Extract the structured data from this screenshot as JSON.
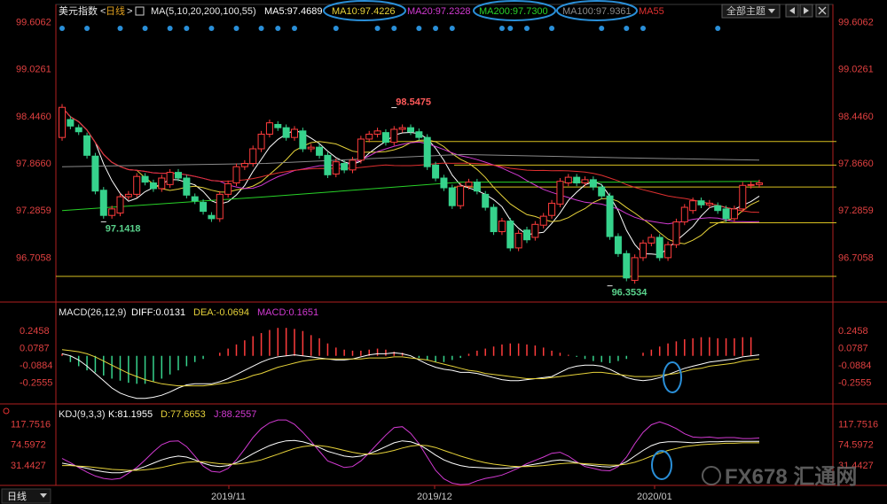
{
  "main_panel": {
    "name": "美元指数",
    "period": "日线",
    "ma_params": "MA(5,10,20,200,100,55)",
    "legend": [
      {
        "label": "MA5:97.4689",
        "color": "#ffffff"
      },
      {
        "label": "MA10:97.4226",
        "color": "#e6d23a"
      },
      {
        "label": "MA20:97.2328",
        "color": "#d23ad2"
      },
      {
        "label": "MA200:97.7300",
        "color": "#28d228"
      },
      {
        "label": "MA100:97.9361",
        "color": "#8a8a8a"
      },
      {
        "label": "MA55",
        "color": "#e03030"
      }
    ],
    "theme_button": "全部主题"
  },
  "macd_panel": {
    "title": "MACD(26,12,9)",
    "legend": [
      {
        "label": "DIFF:0.0131",
        "color": "#ffffff"
      },
      {
        "label": "DEA:-0.0694",
        "color": "#e6d23a"
      },
      {
        "label": "MACD:0.1651",
        "color": "#d23ad2"
      }
    ]
  },
  "kdj_panel": {
    "title": "KDJ(9,3,3)",
    "legend": [
      {
        "label": "K:81.1955",
        "color": "#ffffff"
      },
      {
        "label": "D:77.6653",
        "color": "#e6d23a"
      },
      {
        "label": "J:88.2557",
        "color": "#d23ad2"
      }
    ]
  },
  "bottom_bar": {
    "period": "日线"
  },
  "watermark": "FX678 汇通网",
  "chart_data": {
    "type": "candlestick",
    "price_ticks": [
      "99.6062",
      "99.0261",
      "98.4460",
      "97.8660",
      "97.2859",
      "96.7058"
    ],
    "price_range": [
      96.35,
      99.61
    ],
    "annotations": [
      {
        "label": "98.5475",
        "value": 98.5475
      },
      {
        "label": "97.1418",
        "value": 97.1418
      },
      {
        "label": "96.3534",
        "value": 96.3534
      }
    ],
    "horizontal_levels": [
      98.13,
      97.84,
      97.57,
      97.13,
      96.47
    ],
    "x_labels": [
      "2019/11",
      "2019/12",
      "2020/01"
    ],
    "candles": [
      {
        "o": 98.18,
        "c": 98.55
      },
      {
        "o": 98.4,
        "c": 98.32
      },
      {
        "o": 98.3,
        "c": 98.25
      },
      {
        "o": 98.2,
        "c": 97.96
      },
      {
        "o": 97.95,
        "c": 97.52
      },
      {
        "o": 97.53,
        "c": 97.22
      },
      {
        "o": 97.22,
        "c": 97.3
      },
      {
        "o": 97.25,
        "c": 97.45
      },
      {
        "o": 97.45,
        "c": 97.48
      },
      {
        "o": 97.48,
        "c": 97.7
      },
      {
        "o": 97.7,
        "c": 97.63
      },
      {
        "o": 97.62,
        "c": 97.55
      },
      {
        "o": 97.55,
        "c": 97.68
      },
      {
        "o": 97.6,
        "c": 97.75
      },
      {
        "o": 97.75,
        "c": 97.68
      },
      {
        "o": 97.68,
        "c": 97.47
      },
      {
        "o": 97.45,
        "c": 97.4
      },
      {
        "o": 97.38,
        "c": 97.27
      },
      {
        "o": 97.22,
        "c": 97.18
      },
      {
        "o": 97.18,
        "c": 97.48
      },
      {
        "o": 97.48,
        "c": 97.61
      },
      {
        "o": 97.62,
        "c": 97.82
      },
      {
        "o": 97.82,
        "c": 97.86
      },
      {
        "o": 97.86,
        "c": 98.04
      },
      {
        "o": 98.04,
        "c": 98.22
      },
      {
        "o": 98.22,
        "c": 98.36
      },
      {
        "o": 98.34,
        "c": 98.3
      },
      {
        "o": 98.3,
        "c": 98.18
      },
      {
        "o": 98.18,
        "c": 98.28
      },
      {
        "o": 98.26,
        "c": 98.04
      },
      {
        "o": 98.04,
        "c": 98.06
      },
      {
        "o": 98.06,
        "c": 97.96
      },
      {
        "o": 97.96,
        "c": 97.72
      },
      {
        "o": 97.73,
        "c": 97.88
      },
      {
        "o": 97.86,
        "c": 97.78
      },
      {
        "o": 97.78,
        "c": 97.9
      },
      {
        "o": 97.9,
        "c": 98.16
      },
      {
        "o": 98.16,
        "c": 98.22
      },
      {
        "o": 98.22,
        "c": 98.26
      },
      {
        "o": 98.24,
        "c": 98.12
      },
      {
        "o": 98.12,
        "c": 98.28
      },
      {
        "o": 98.28,
        "c": 98.3
      },
      {
        "o": 98.3,
        "c": 98.25
      },
      {
        "o": 98.25,
        "c": 98.18
      },
      {
        "o": 98.18,
        "c": 97.82
      },
      {
        "o": 97.84,
        "c": 97.68
      },
      {
        "o": 97.68,
        "c": 97.56
      },
      {
        "o": 97.56,
        "c": 97.34
      },
      {
        "o": 97.34,
        "c": 97.58
      },
      {
        "o": 97.58,
        "c": 97.63
      },
      {
        "o": 97.63,
        "c": 97.52
      },
      {
        "o": 97.48,
        "c": 97.32
      },
      {
        "o": 97.32,
        "c": 97.02
      },
      {
        "o": 97.02,
        "c": 97.15
      },
      {
        "o": 97.15,
        "c": 96.82
      },
      {
        "o": 96.82,
        "c": 97.0
      },
      {
        "o": 97.04,
        "c": 96.92
      },
      {
        "o": 96.95,
        "c": 97.11
      },
      {
        "o": 97.1,
        "c": 97.21
      },
      {
        "o": 97.22,
        "c": 97.37
      },
      {
        "o": 97.36,
        "c": 97.64
      },
      {
        "o": 97.62,
        "c": 97.69
      },
      {
        "o": 97.69,
        "c": 97.62
      },
      {
        "o": 97.62,
        "c": 97.66
      },
      {
        "o": 97.66,
        "c": 97.57
      },
      {
        "o": 97.57,
        "c": 97.46
      },
      {
        "o": 97.46,
        "c": 96.96
      },
      {
        "o": 96.96,
        "c": 96.75
      },
      {
        "o": 96.75,
        "c": 96.45
      },
      {
        "o": 96.42,
        "c": 96.7
      },
      {
        "o": 96.7,
        "c": 96.88
      },
      {
        "o": 96.88,
        "c": 96.95
      },
      {
        "o": 96.95,
        "c": 96.7
      },
      {
        "o": 96.7,
        "c": 96.86
      },
      {
        "o": 96.86,
        "c": 97.14
      },
      {
        "o": 97.14,
        "c": 97.32
      },
      {
        "o": 97.28,
        "c": 97.4
      },
      {
        "o": 97.4,
        "c": 97.35
      },
      {
        "o": 97.35,
        "c": 97.37
      },
      {
        "o": 97.34,
        "c": 97.28
      },
      {
        "o": 97.3,
        "c": 97.18
      },
      {
        "o": 97.18,
        "c": 97.3
      },
      {
        "o": 97.3,
        "c": 97.59
      },
      {
        "o": 97.59,
        "c": 97.6
      },
      {
        "o": 97.6,
        "c": 97.62
      }
    ],
    "macd_ticks": [
      "0.2458",
      "0.0787",
      "-0.0884",
      "-0.2555"
    ],
    "macd_range": [
      -0.43,
      0.34
    ],
    "macd_hist": [
      0.02,
      -0.06,
      -0.1,
      -0.14,
      -0.16,
      -0.19,
      -0.22,
      -0.24,
      -0.26,
      -0.27,
      -0.27,
      -0.25,
      -0.22,
      -0.18,
      -0.14,
      -0.1,
      -0.06,
      -0.03,
      0.0,
      0.03,
      0.07,
      0.11,
      0.15,
      0.19,
      0.22,
      0.25,
      0.27,
      0.27,
      0.26,
      0.24,
      0.2,
      0.17,
      0.12,
      0.08,
      0.06,
      0.05,
      0.05,
      0.06,
      0.07,
      0.06,
      0.04,
      0.03,
      0.0,
      -0.02,
      -0.04,
      -0.06,
      -0.06,
      -0.04,
      -0.02,
      0.02,
      0.05,
      0.07,
      0.09,
      0.11,
      0.12,
      0.12,
      0.11,
      0.1,
      0.08,
      0.05,
      0.03,
      0.01,
      -0.01,
      -0.03,
      -0.05,
      -0.06,
      -0.07,
      -0.05,
      -0.03,
      0.0,
      0.03,
      0.06,
      0.09,
      0.12,
      0.14,
      0.16,
      0.17,
      0.18,
      0.18,
      0.17,
      0.17,
      0.17,
      0.18,
      0.18
    ],
    "macd_diff": [
      0.02,
      0.0,
      -0.04,
      -0.1,
      -0.17,
      -0.24,
      -0.31,
      -0.36,
      -0.39,
      -0.41,
      -0.41,
      -0.4,
      -0.38,
      -0.35,
      -0.31,
      -0.28,
      -0.27,
      -0.27,
      -0.27,
      -0.25,
      -0.22,
      -0.18,
      -0.14,
      -0.1,
      -0.06,
      -0.03,
      -0.01,
      0.0,
      0.01,
      0.0,
      -0.01,
      -0.02,
      -0.03,
      -0.04,
      -0.04,
      -0.03,
      -0.01,
      0.01,
      0.02,
      0.02,
      0.03,
      0.02,
      0.0,
      -0.04,
      -0.08,
      -0.11,
      -0.13,
      -0.14,
      -0.16,
      -0.16,
      -0.17,
      -0.19,
      -0.21,
      -0.23,
      -0.24,
      -0.24,
      -0.23,
      -0.22,
      -0.21,
      -0.2,
      -0.16,
      -0.12,
      -0.1,
      -0.09,
      -0.09,
      -0.1,
      -0.13,
      -0.17,
      -0.21,
      -0.23,
      -0.24,
      -0.23,
      -0.21,
      -0.18,
      -0.15,
      -0.12,
      -0.1,
      -0.08,
      -0.06,
      -0.05,
      -0.04,
      -0.03,
      -0.01,
      0.0,
      0.01
    ],
    "macd_dea": [
      0.06,
      0.05,
      0.04,
      0.02,
      -0.01,
      -0.05,
      -0.09,
      -0.13,
      -0.17,
      -0.2,
      -0.23,
      -0.25,
      -0.27,
      -0.28,
      -0.29,
      -0.29,
      -0.29,
      -0.29,
      -0.28,
      -0.27,
      -0.26,
      -0.24,
      -0.22,
      -0.19,
      -0.17,
      -0.14,
      -0.11,
      -0.09,
      -0.07,
      -0.05,
      -0.04,
      -0.03,
      -0.03,
      -0.03,
      -0.03,
      -0.03,
      -0.03,
      -0.02,
      -0.02,
      -0.02,
      -0.01,
      -0.01,
      -0.02,
      -0.03,
      -0.04,
      -0.06,
      -0.08,
      -0.1,
      -0.12,
      -0.14,
      -0.15,
      -0.17,
      -0.18,
      -0.19,
      -0.2,
      -0.21,
      -0.22,
      -0.22,
      -0.22,
      -0.21,
      -0.2,
      -0.19,
      -0.18,
      -0.17,
      -0.16,
      -0.16,
      -0.17,
      -0.18,
      -0.19,
      -0.2,
      -0.2,
      -0.2,
      -0.19,
      -0.18,
      -0.17,
      -0.15,
      -0.13,
      -0.12,
      -0.1,
      -0.09,
      -0.08,
      -0.07,
      -0.05,
      -0.04,
      -0.03
    ],
    "kdj_ticks": [
      "117.7516",
      "74.5972",
      "31.4427"
    ],
    "kdj_range": [
      -8,
      130
    ],
    "kdj_k": [
      35,
      32,
      28,
      24,
      20,
      17,
      15,
      15,
      18,
      22,
      28,
      35,
      42,
      47,
      50,
      48,
      42,
      35,
      30,
      28,
      30,
      36,
      45,
      55,
      64,
      72,
      78,
      82,
      83,
      80,
      75,
      68,
      60,
      55,
      50,
      48,
      50,
      55,
      62,
      70,
      78,
      82,
      80,
      74,
      64,
      52,
      42,
      35,
      30,
      27,
      26,
      25,
      24,
      24,
      25,
      27,
      30,
      33,
      36,
      40,
      42,
      40,
      36,
      32,
      30,
      28,
      27,
      30,
      38,
      50,
      62,
      72,
      78,
      80,
      80,
      79,
      78,
      79,
      80,
      80,
      81,
      81,
      81,
      81,
      81
    ],
    "kdj_d": [
      30,
      30,
      29,
      28,
      26,
      24,
      22,
      21,
      20,
      20,
      21,
      23,
      26,
      30,
      34,
      37,
      38,
      38,
      36,
      34,
      33,
      33,
      35,
      38,
      42,
      48,
      54,
      60,
      66,
      70,
      72,
      72,
      70,
      66,
      62,
      58,
      55,
      54,
      55,
      58,
      62,
      67,
      71,
      73,
      72,
      68,
      62,
      56,
      50,
      45,
      40,
      36,
      33,
      31,
      29,
      28,
      28,
      29,
      30,
      32,
      34,
      35,
      35,
      34,
      33,
      32,
      31,
      31,
      33,
      37,
      43,
      50,
      56,
      62,
      66,
      70,
      72,
      74,
      75,
      76,
      77,
      77,
      78,
      78,
      78
    ],
    "kdj_j": [
      45,
      36,
      26,
      16,
      8,
      3,
      1,
      3,
      14,
      26,
      42,
      59,
      74,
      81,
      82,
      70,
      50,
      29,
      18,
      16,
      24,
      42,
      65,
      89,
      108,
      120,
      126,
      126,
      117,
      100,
      81,
      60,
      40,
      33,
      26,
      28,
      40,
      57,
      76,
      94,
      110,
      112,
      98,
      76,
      48,
      20,
      2,
      -7,
      -10,
      -9,
      -2,
      3,
      6,
      10,
      17,
      25,
      34,
      41,
      48,
      56,
      58,
      50,
      38,
      28,
      24,
      20,
      19,
      28,
      48,
      76,
      100,
      116,
      122,
      116,
      108,
      97,
      90,
      89,
      90,
      88,
      89,
      89,
      87,
      87,
      88
    ]
  }
}
